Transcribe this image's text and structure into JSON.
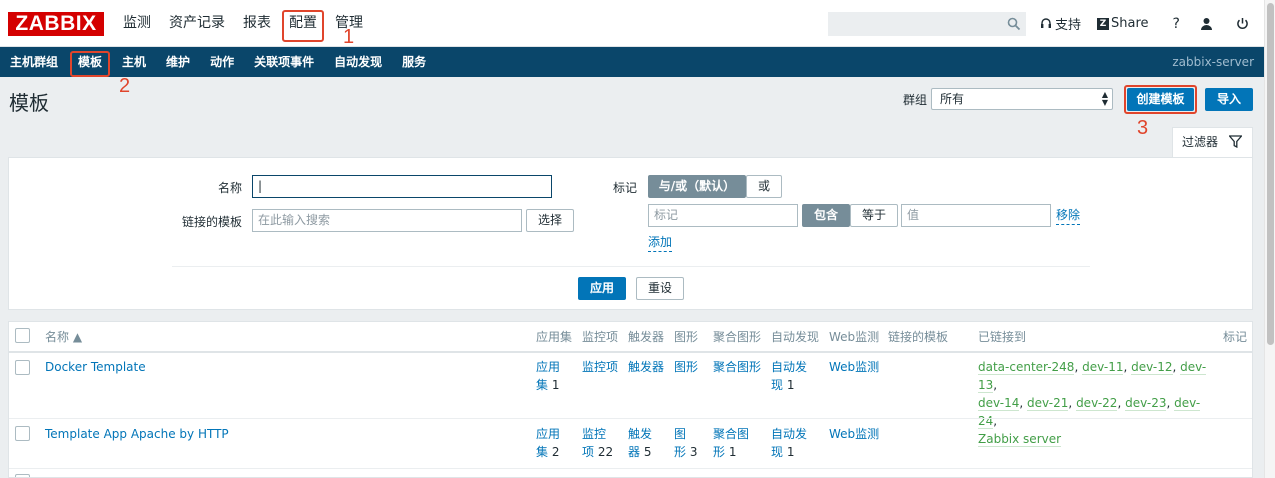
{
  "logo": "ZABBIX",
  "main_menu": [
    "监测",
    "资产记录",
    "报表",
    "配置",
    "管理"
  ],
  "top_links": {
    "support": "支持",
    "share": "Share",
    "help": "?"
  },
  "sub_menu": [
    "主机群组",
    "模板",
    "主机",
    "维护",
    "动作",
    "关联项事件",
    "自动发现",
    "服务"
  ],
  "server_name": "zabbix-server",
  "annotations": [
    "1",
    "2",
    "3"
  ],
  "page": {
    "title": "模板",
    "group_label": "群组",
    "group_value": "所有",
    "create_button": "创建模板",
    "import_button": "导入"
  },
  "filter": {
    "tab_label": "过滤器",
    "name_label": "名称",
    "name_value": "",
    "linked_label": "链接的模板",
    "linked_placeholder": "在此输入搜索",
    "select_button": "选择",
    "tags_label": "标记",
    "andor": "与/或（默认）",
    "or": "或",
    "tag_placeholder": "标记",
    "contains": "包含",
    "equals": "等于",
    "value_placeholder": "值",
    "remove": "移除",
    "add": "添加",
    "apply": "应用",
    "reset": "重设"
  },
  "table": {
    "headers": {
      "name": "名称 ▲",
      "apps": "应用集",
      "items": "监控项",
      "triggers": "触发器",
      "graphs": "图形",
      "screens": "聚合图形",
      "discovery": "自动发现",
      "web": "Web监测",
      "linked_templates": "链接的模板",
      "linked_to": "已链接到",
      "tags": "标记"
    },
    "rows": [
      {
        "name": "Docker Template",
        "apps_a": "应用",
        "apps_b": "集",
        "apps_count": "1",
        "items": "监控项",
        "triggers": "触发器",
        "graphs": "图形",
        "screens": "聚合图形",
        "discovery_a": "自动发",
        "discovery_b": "现",
        "discovery_count": "1",
        "web": "Web监测",
        "linked": [
          "data-center-248",
          "dev-11",
          "dev-12",
          "dev-13",
          "dev-14",
          "dev-21",
          "dev-22",
          "dev-23",
          "dev-24",
          "Zabbix server"
        ]
      },
      {
        "name": "Template App Apache by HTTP",
        "apps_a": "应用",
        "apps_b": "集",
        "apps_count": "2",
        "items_a": "监控",
        "items_b": "项",
        "items_count": "22",
        "triggers_a": "触发",
        "triggers_b": "器",
        "triggers_count": "5",
        "graphs_a": "图",
        "graphs_b": "形",
        "graphs_count": "3",
        "screens_a": "聚合图",
        "screens_b": "形",
        "screens_count": "1",
        "discovery_a": "自动发",
        "discovery_b": "现",
        "discovery_count": "1",
        "web": "Web监测"
      }
    ]
  }
}
